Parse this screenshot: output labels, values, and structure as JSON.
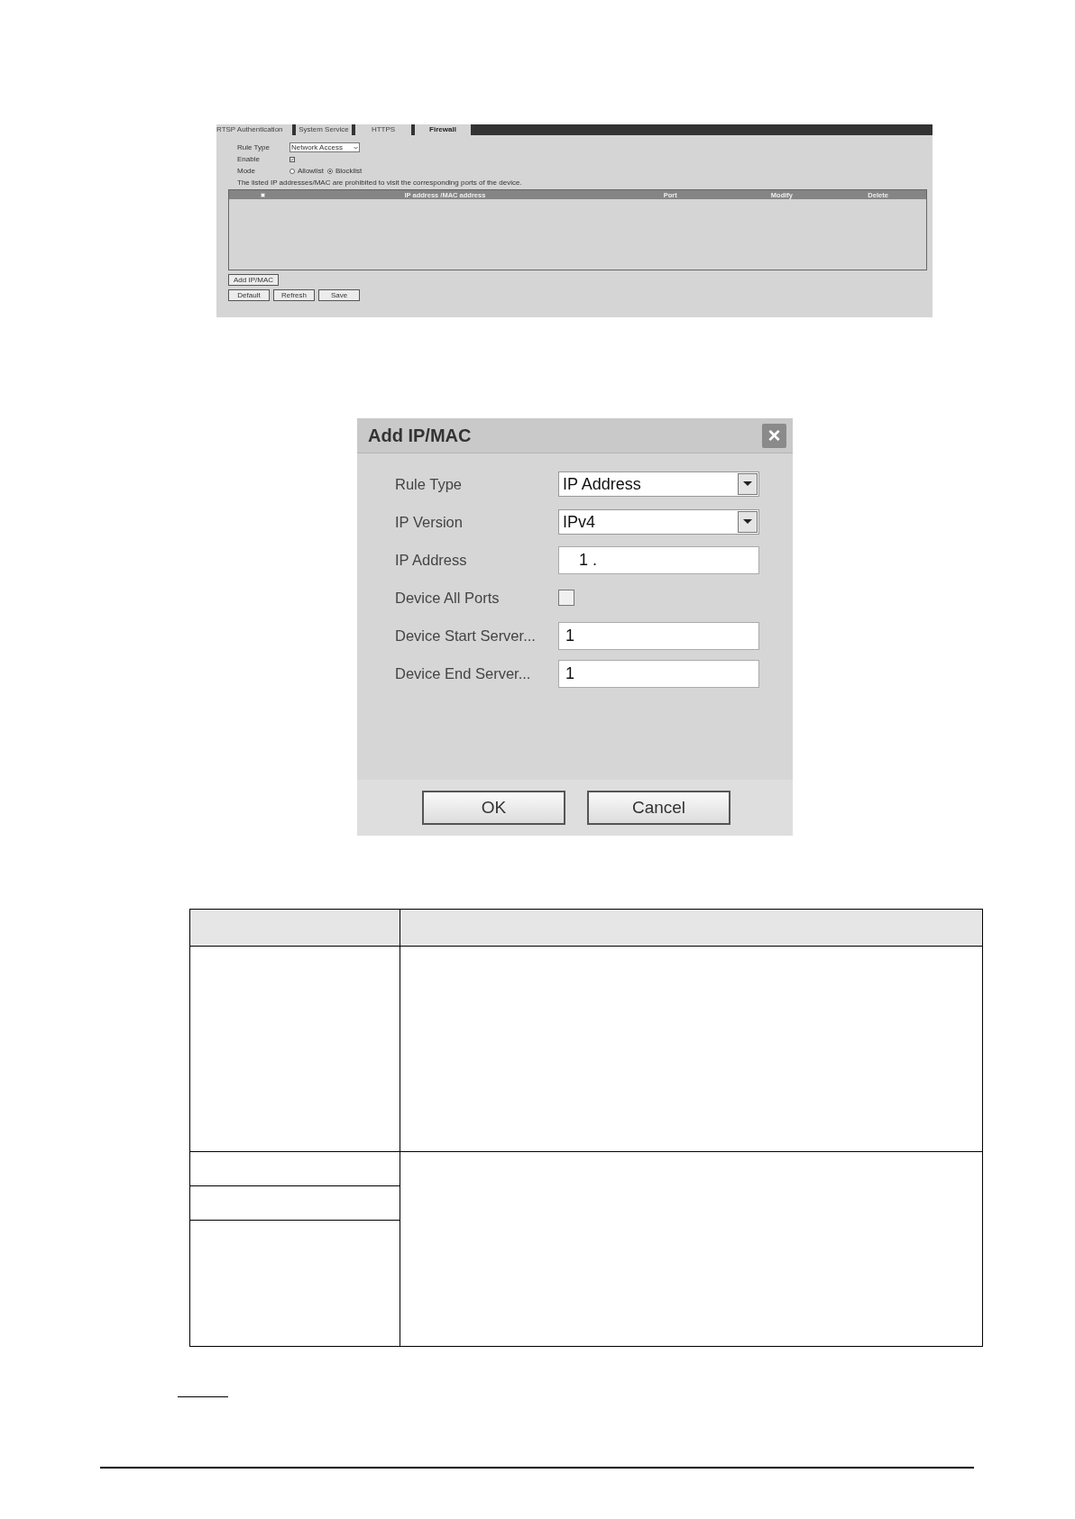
{
  "firewall_screen": {
    "tabs": [
      {
        "label": "RTSP Authentication",
        "selected": false
      },
      {
        "label": "System Service",
        "selected": false
      },
      {
        "label": "HTTPS",
        "selected": false
      },
      {
        "label": "Firewall",
        "selected": true
      }
    ],
    "fields": [
      {
        "kind": "select",
        "label": "Rule Type",
        "value": "Network Access"
      },
      {
        "kind": "checkbox",
        "label": "Enable",
        "checked": true
      },
      {
        "kind": "radio",
        "label": "Mode",
        "options": [
          {
            "label": "Allowlist",
            "selected": false
          },
          {
            "label": "Blocklist",
            "selected": true
          }
        ]
      }
    ],
    "notice": "The listed IP addresses/MAC are prohibited to visit the corresponding ports of the device.",
    "table": {
      "select_all": {
        "checked": false
      },
      "columns": [
        "IP address /MAC address",
        "Port",
        "Modify",
        "Delete"
      ]
    },
    "add_button": "Add IP/MAC",
    "buttons": [
      "Default",
      "Refresh",
      "Save"
    ]
  },
  "dialog": {
    "title": "Add IP/MAC",
    "close": "×",
    "fields": [
      {
        "kind": "select",
        "label": "Rule Type",
        "value": "IP Address"
      },
      {
        "kind": "select",
        "label": "IP Version",
        "value": "IPv4"
      },
      {
        "kind": "ip",
        "label": "IP Address",
        "value": "1 ."
      },
      {
        "kind": "checkbox",
        "label": "Device All Ports",
        "checked": false
      },
      {
        "kind": "text",
        "label": "Device Start Server...",
        "value": "1"
      },
      {
        "kind": "text",
        "label": "Device End Server...",
        "value": "1"
      }
    ],
    "buttons": [
      "OK",
      "Cancel"
    ]
  }
}
